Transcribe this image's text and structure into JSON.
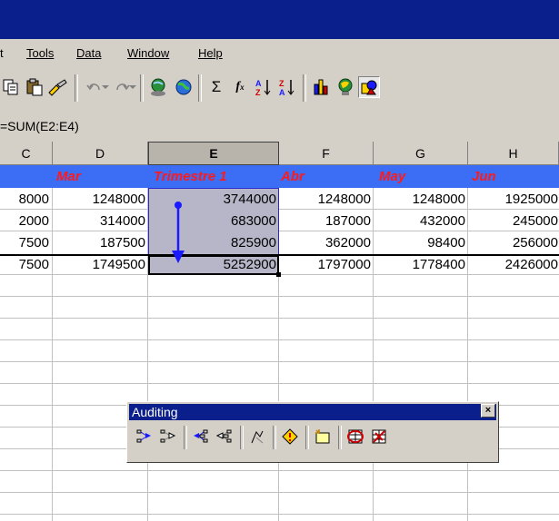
{
  "menu": [
    "t",
    "Tools",
    "Data",
    "Window",
    "Help"
  ],
  "formula_bar": {
    "value": "=SUM(E2:E4)"
  },
  "columns": [
    "C",
    "D",
    "E",
    "F",
    "G",
    "H"
  ],
  "header_row": [
    "",
    "Mar",
    "Trimestre 1",
    "Abr",
    "May",
    "Jun"
  ],
  "rows": [
    [
      "8000",
      "1248000",
      "3744000",
      "1248000",
      "1248000",
      "1925000"
    ],
    [
      "2000",
      "314000",
      "683000",
      "187000",
      "432000",
      "245000"
    ],
    [
      "7500",
      "187500",
      "825900",
      "362000",
      "98400",
      "256000"
    ],
    [
      "7500",
      "1749500",
      "5252900",
      "1797000",
      "1778400",
      "2426000"
    ]
  ],
  "auditing_palette": {
    "title": "Auditing",
    "close": "×"
  },
  "colors": {
    "title_bar": "#0a1e8c",
    "header_fill": "#3b6ef5",
    "header_text": "#ff1a1a",
    "selection": "#b6b6c8",
    "trace_arrow": "#1a1aff"
  },
  "icons": {
    "toolbar": [
      "copy-icon",
      "paste-icon",
      "format-painter-icon",
      "undo-icon",
      "redo-icon",
      "insert-hyperlink-icon",
      "web-toolbar-icon",
      "autosum-icon",
      "paste-function-icon",
      "sort-ascending-icon",
      "sort-descending-icon",
      "chart-wizard-icon",
      "map-icon",
      "drawing-icon"
    ],
    "auditing": [
      "trace-precedents-icon",
      "remove-precedent-arrows-icon",
      "trace-dependents-icon",
      "remove-dependent-arrows-icon",
      "remove-all-arrows-icon",
      "trace-error-icon",
      "new-comment-icon",
      "circle-invalid-data-icon",
      "clear-validation-circles-icon"
    ]
  }
}
